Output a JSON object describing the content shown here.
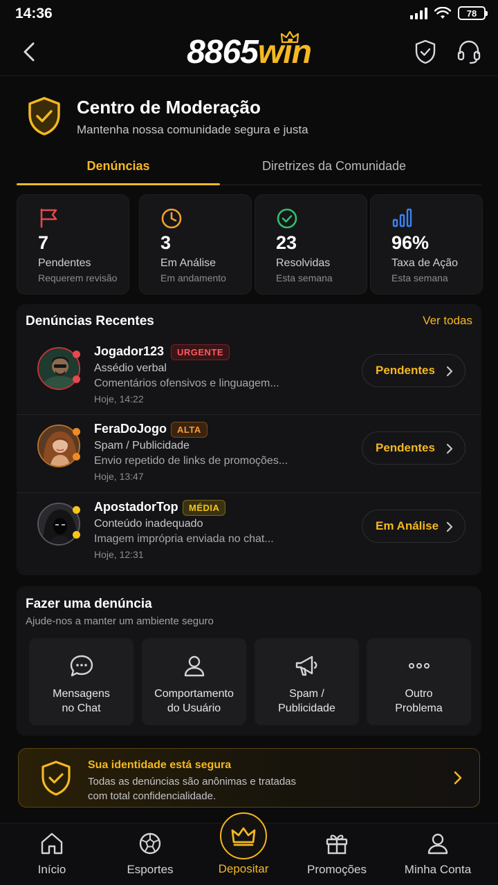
{
  "status_bar": {
    "time": "14:36",
    "battery": "78"
  },
  "header": {
    "logo_number": "8865",
    "logo_word": "win"
  },
  "hero": {
    "title": "Centro de Moderação",
    "subtitle": "Mantenha nossa comunidade segura e justa"
  },
  "tabs": [
    {
      "label": "Denúncias",
      "active": true
    },
    {
      "label": "Diretrizes da Comunidade",
      "active": false
    }
  ],
  "stats": [
    {
      "value": "7",
      "label": "Pendentes",
      "sub": "Requerem revisão",
      "icon": "flag-icon",
      "color": "#e5484d"
    },
    {
      "value": "3",
      "label": "Em Análise",
      "sub": "Em andamento",
      "icon": "clock-icon",
      "color": "#f0a030"
    },
    {
      "value": "23",
      "label": "Resolvidas",
      "sub": "Esta semana",
      "icon": "check-circle-icon",
      "color": "#2fbf71"
    },
    {
      "value": "96%",
      "label": "Taxa de Ação",
      "sub": "Esta semana",
      "icon": "bar-chart-icon",
      "color": "#3b82f6"
    }
  ],
  "recent": {
    "title": "Denúncias Recentes",
    "see_all": "Ver todas",
    "items": [
      {
        "user": "Jogador123",
        "badge": "URGENTE",
        "badge_color": "#e5484d",
        "category": "Assédio verbal",
        "description": "Comentários ofensivos e linguagem...",
        "time": "Hoje, 14:22",
        "status": "Pendentes"
      },
      {
        "user": "FeraDoJogo",
        "badge": "ALTA",
        "badge_color": "#f08a24",
        "category": "Spam / Publicidade",
        "description": "Envio repetido de links de promoções...",
        "time": "Hoje, 13:47",
        "status": "Pendentes"
      },
      {
        "user": "ApostadorTop",
        "badge": "MÉDIA",
        "badge_color": "#f5c518",
        "category": "Conteúdo inadequado",
        "description": "Imagem imprópria enviada no chat...",
        "time": "Hoje, 12:31",
        "status": "Em Análise"
      }
    ]
  },
  "make_report": {
    "title": "Fazer uma denúncia",
    "subtitle": "Ajude-nos a manter um ambiente seguro",
    "options": [
      {
        "line1": "Mensagens",
        "line2": "no Chat",
        "icon": "chat-bubble-icon"
      },
      {
        "line1": "Comportamento",
        "line2": "do Usuário",
        "icon": "user-icon"
      },
      {
        "line1": "Spam /",
        "line2": "Publicidade",
        "icon": "megaphone-icon"
      },
      {
        "line1": "Outro",
        "line2": "Problema",
        "icon": "more-icon"
      }
    ]
  },
  "identity": {
    "title": "Sua identidade está segura",
    "line1": "Todas as denúncias são anônimas e tratadas",
    "line2": "com total confidencialidade."
  },
  "nav": [
    {
      "label": "Início",
      "icon": "home-icon"
    },
    {
      "label": "Esportes",
      "icon": "soccer-ball-icon"
    },
    {
      "label": "Depositar",
      "icon": "crown-icon"
    },
    {
      "label": "Promoções",
      "icon": "gift-icon"
    },
    {
      "label": "Minha Conta",
      "icon": "user-icon"
    }
  ],
  "colors": {
    "accent": "#f5b820",
    "background": "#0b0b0c",
    "card": "#141416"
  }
}
